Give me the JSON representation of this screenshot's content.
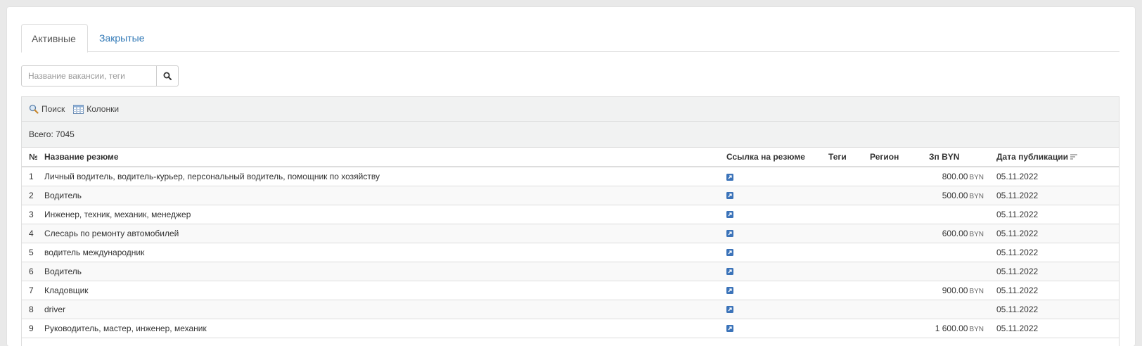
{
  "tabs": [
    {
      "label": "Активные",
      "active": true
    },
    {
      "label": "Закрытые",
      "active": false
    }
  ],
  "search": {
    "placeholder": "Название вакансии, теги",
    "value": ""
  },
  "toolbar": {
    "search_label": "Поиск",
    "columns_label": "Колонки"
  },
  "summary": {
    "total_label": "Всего: 7045"
  },
  "table": {
    "headers": {
      "num": "№",
      "title": "Название резюме",
      "link": "Ссылка на резюме",
      "tags": "Теги",
      "region": "Регион",
      "salary": "Зп BYN",
      "date": "Дата публикации"
    },
    "rows": [
      {
        "num": "1",
        "title": "Личный водитель, водитель-курьер, персональный водитель, помощник по хозяйству",
        "tags": "",
        "region": "",
        "salary": "800.00",
        "currency": "BYN",
        "date": "05.11.2022"
      },
      {
        "num": "2",
        "title": "Водитель",
        "tags": "",
        "region": "",
        "salary": "500.00",
        "currency": "BYN",
        "date": "05.11.2022"
      },
      {
        "num": "3",
        "title": "Инженер, техник, механик, менеджер",
        "tags": "",
        "region": "",
        "salary": "",
        "currency": "",
        "date": "05.11.2022"
      },
      {
        "num": "4",
        "title": "Слесарь по ремонту автомобилей",
        "tags": "",
        "region": "",
        "salary": "600.00",
        "currency": "BYN",
        "date": "05.11.2022"
      },
      {
        "num": "5",
        "title": "водитель международник",
        "tags": "",
        "region": "",
        "salary": "",
        "currency": "",
        "date": "05.11.2022"
      },
      {
        "num": "6",
        "title": "Водитель",
        "tags": "",
        "region": "",
        "salary": "",
        "currency": "",
        "date": "05.11.2022"
      },
      {
        "num": "7",
        "title": "Кладовщик",
        "tags": "",
        "region": "",
        "salary": "900.00",
        "currency": "BYN",
        "date": "05.11.2022"
      },
      {
        "num": "8",
        "title": "driver",
        "tags": "",
        "region": "",
        "salary": "",
        "currency": "",
        "date": "05.11.2022"
      },
      {
        "num": "9",
        "title": "Руководитель, мастер, инженер, механик",
        "tags": "",
        "region": "",
        "salary": "1 600.00",
        "currency": "BYN",
        "date": "05.11.2022"
      }
    ]
  },
  "colors": {
    "link": "#337ab7",
    "link_icon": "#3b73b9",
    "toolbar_bg": "#f1f2f2",
    "border": "#dddddd"
  },
  "icons": {
    "search_button": "search-icon",
    "toolbar_search": "magnifier-icon",
    "toolbar_columns": "columns-icon",
    "row_link": "external-link-icon",
    "sort": "sort-desc-icon"
  }
}
